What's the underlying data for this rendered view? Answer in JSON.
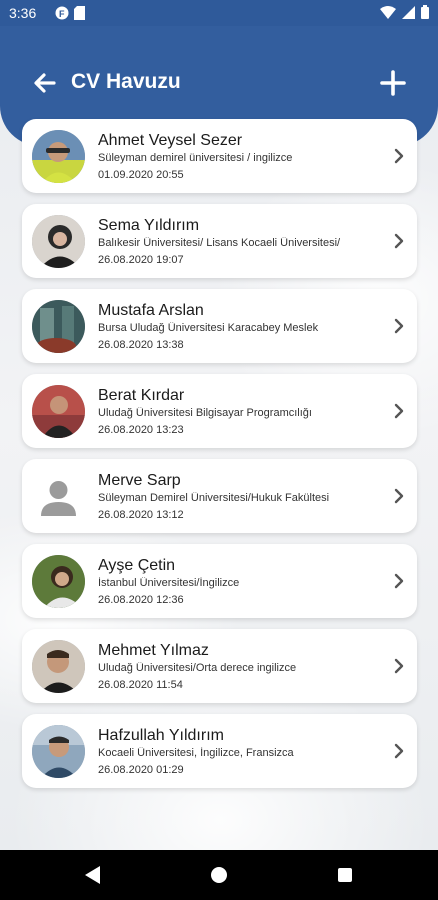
{
  "status_bar": {
    "time": "3:36"
  },
  "header": {
    "title": "CV Havuzu"
  },
  "colors": {
    "header_blue": "#335e9e",
    "status_blue": "#2f5a9a"
  },
  "cv_list": [
    {
      "name": "Ahmet Veysel Sezer",
      "school": "Süleyman demirel üniversitesi / ingilizce",
      "date": "01.09.2020 20:55"
    },
    {
      "name": "Sema Yıldırım",
      "school": "Balıkesir Üniversitesi/ Lisans Kocaeli Üniversitesi/",
      "date": "26.08.2020 19:07"
    },
    {
      "name": "Mustafa Arslan",
      "school": "Bursa Uludağ Üniversitesi Karacabey Meslek",
      "date": "26.08.2020 13:38"
    },
    {
      "name": "Berat Kırdar",
      "school": "Uludağ Üniversitesi Bilgisayar Programcılığı",
      "date": "26.08.2020 13:23"
    },
    {
      "name": "Merve Sarp",
      "school": "Süleyman Demirel Üniversitesi/Hukuk Fakültesi",
      "date": "26.08.2020 13:12"
    },
    {
      "name": "Ayşe Çetin",
      "school": "İstanbul Üniversitesi/İngilizce",
      "date": "26.08.2020 12:36"
    },
    {
      "name": "Mehmet Yılmaz",
      "school": "Uludağ Üniversitesi/Orta derece ingilizce",
      "date": "26.08.2020 11:54"
    },
    {
      "name": "Hafzullah Yıldırım",
      "school": "Kocaeli Üniversitesi, İngilizce, Fransizca",
      "date": "26.08.2020 01:29"
    }
  ]
}
